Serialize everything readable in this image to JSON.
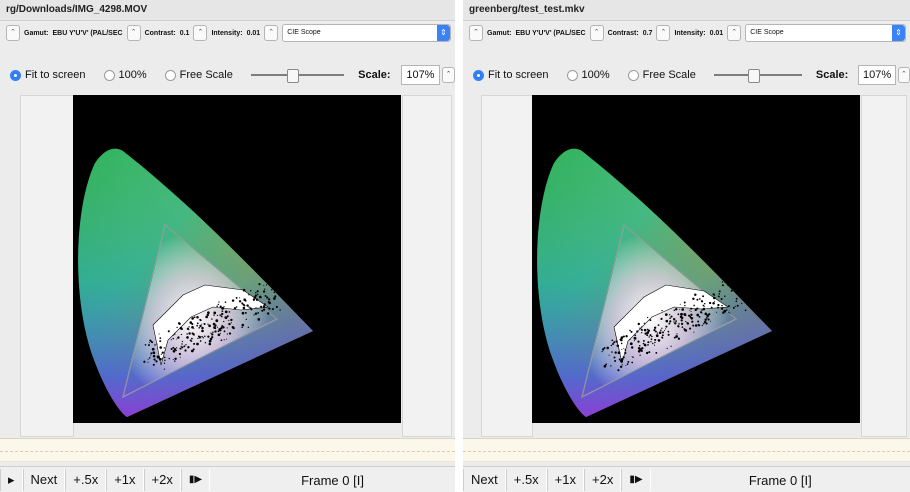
{
  "left": {
    "title": "rg/Downloads/IMG_4298.MOV",
    "gamut_label": "Gamut:",
    "gamut_value": "EBU Y'U'V' (PAL/SEC",
    "contrast_label": "Contrast:",
    "contrast_value": "0.1",
    "intensity_label": "Intensity:",
    "intensity_value": "0.01",
    "scope_value": "CIE Scope",
    "fit_label": "Fit to screen",
    "hundred_label": "100%",
    "free_label": "Free Scale",
    "scale_label": "Scale:",
    "scale_value": "107%",
    "next_label": "Next",
    "speed_half_label": "+.5x",
    "speed_one_label": "+1x",
    "speed_two_label": "+2x",
    "frame_label": "Frame 0 [I]"
  },
  "right": {
    "title": "greenberg/test_test.mkv",
    "gamut_label": "Gamut:",
    "gamut_value": "EBU Y'U'V' (PAL/SEC",
    "contrast_label": "Contrast:",
    "contrast_value": "0.7",
    "intensity_label": "Intensity:",
    "intensity_value": "0.01",
    "scope_value": "CIE Scope",
    "fit_label": "Fit to screen",
    "hundred_label": "100%",
    "free_label": "Free Scale",
    "scale_label": "Scale:",
    "scale_value": "107%",
    "next_label": "Next",
    "speed_half_label": "+.5x",
    "speed_one_label": "+1x",
    "speed_two_label": "+2x",
    "frame_label": "Frame 0 [I]"
  },
  "icons": {
    "stepper": "stepper-icon",
    "dropdown": "dropdown-arrow-icon",
    "play_step": "play-step-icon",
    "prev": "previous-arrow-icon"
  },
  "colors": {
    "accent": "#2f7df6",
    "viewport_bg": "#000000",
    "timeline_bg": "#fbf7ea"
  },
  "slider_position": 0.45
}
